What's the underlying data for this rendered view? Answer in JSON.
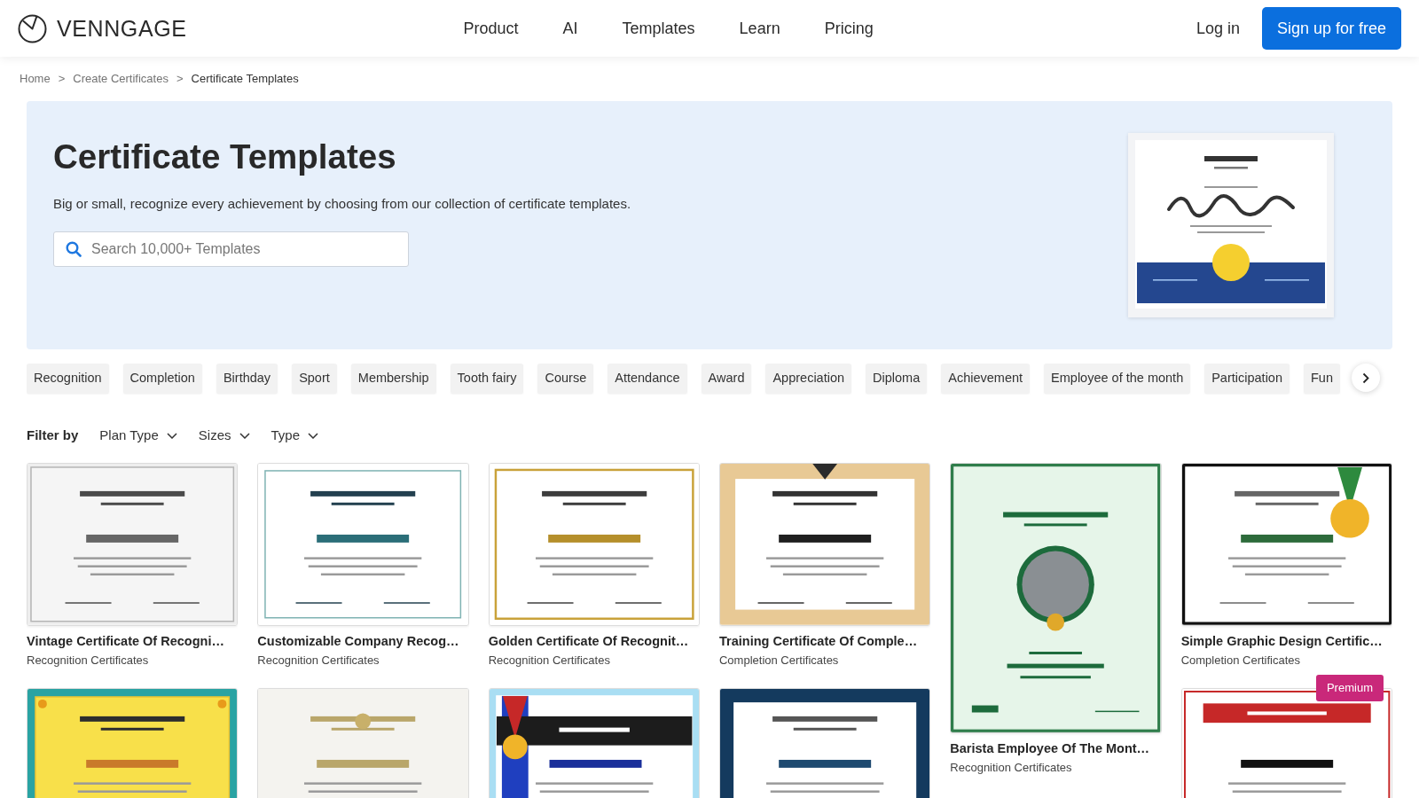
{
  "navbar": {
    "logo": "VENNGAGE",
    "links": [
      "Product",
      "AI",
      "Templates",
      "Learn",
      "Pricing"
    ],
    "login": "Log in",
    "signup": "Sign up for free"
  },
  "breadcrumb": [
    {
      "label": "Home",
      "current": false
    },
    {
      "separator": ">",
      "label": "Create Certificates",
      "current": false
    },
    {
      "separator": ">",
      "label": "Certificate Templates",
      "current": true
    }
  ],
  "hero": {
    "title": "Certificate Templates",
    "description": "Big or small, recognize every achievement by choosing from our collection of certificate templates.",
    "search": {
      "placeholder": "Search 10,000+ Templates"
    }
  },
  "categories": [
    "Recognition",
    "Completion",
    "Birthday",
    "Sport",
    "Membership",
    "Tooth fairy",
    "Course",
    "Attendance",
    "Award",
    "Appreciation",
    "Diploma",
    "Achievement",
    "Employee of the month",
    "Participation",
    "Fun"
  ],
  "filters": {
    "label": "Filter by",
    "dropdowns": [
      "Plan Type",
      "Sizes",
      "Type"
    ]
  },
  "template_columns": [
    [
      {
        "title": "Vintage Certificate Of Recogni…",
        "category": "Recognition Certificates",
        "kind": "vintage",
        "portrait": false
      },
      {
        "kind": "yellow",
        "portrait": false
      }
    ],
    [
      {
        "title": "Customizable Company Recog…",
        "category": "Recognition Certificates",
        "kind": "framed",
        "portrait": false
      },
      {
        "kind": "leaf",
        "portrait": false
      }
    ],
    [
      {
        "title": "Golden Certificate Of Recognit…",
        "category": "Recognition Certificates",
        "kind": "gold",
        "portrait": false
      },
      {
        "kind": "blue",
        "portrait": false
      }
    ],
    [
      {
        "title": "Training Certificate Of Comple…",
        "category": "Completion Certificates",
        "kind": "beige",
        "portrait": false
      },
      {
        "kind": "navy",
        "portrait": false
      }
    ],
    [
      {
        "title": "Barista Employee Of The Mont…",
        "category": "Recognition Certificates",
        "kind": "green",
        "portrait": true
      }
    ],
    [
      {
        "title": "Simple Graphic Design Certific…",
        "category": "Completion Certificates",
        "kind": "medal",
        "portrait": false
      },
      {
        "kind": "ribbon",
        "portrait": false,
        "badge": "Premium"
      }
    ]
  ]
}
